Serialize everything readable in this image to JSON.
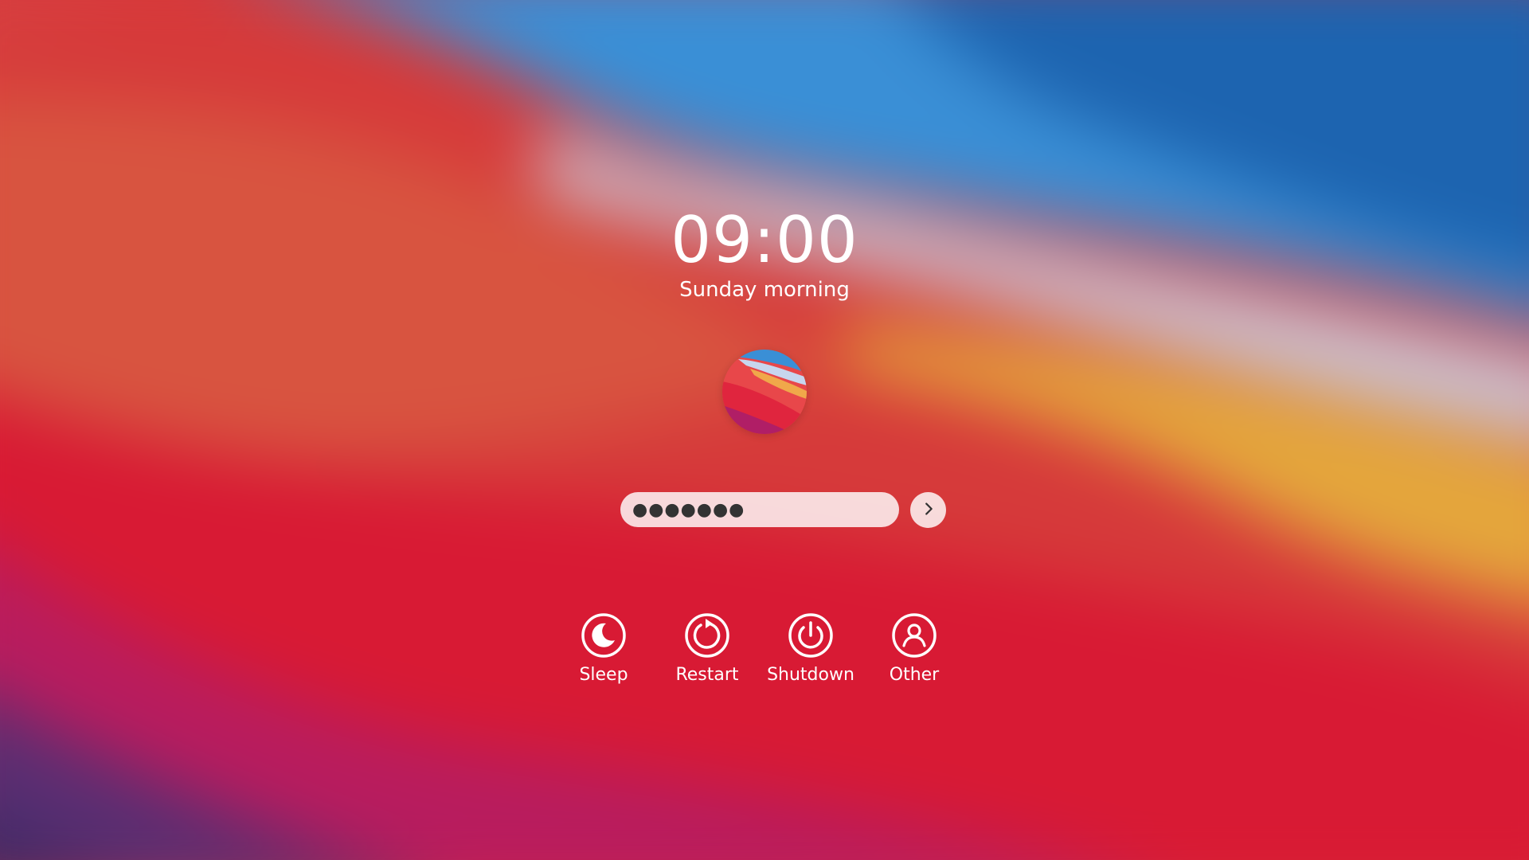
{
  "lock_screen": {
    "time": "09:00",
    "greeting": "Sunday morning",
    "password_masked": "●●●●●●●",
    "submit_icon": "chevron-right-icon",
    "actions": [
      {
        "label": "Sleep",
        "icon": "moon-icon"
      },
      {
        "label": "Restart",
        "icon": "restart-icon"
      },
      {
        "label": "Shutdown",
        "icon": "power-icon"
      },
      {
        "label": "Other",
        "icon": "user-icon"
      }
    ]
  },
  "colors": {
    "text": "#ffffff",
    "field_background": "#f2dcd8",
    "field_text": "#333333",
    "wallpaper_red": "#d8323a",
    "wallpaper_blue": "#2f7fc8",
    "wallpaper_orange": "#e8a23c",
    "wallpaper_purple": "#4a2f70"
  }
}
